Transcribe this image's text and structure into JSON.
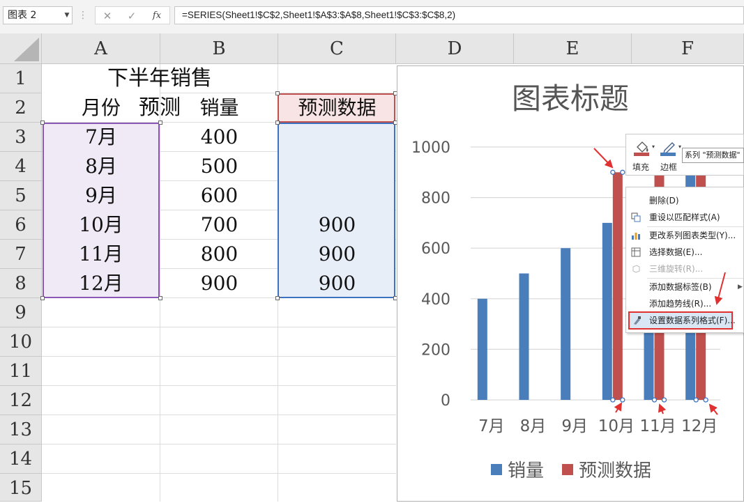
{
  "name_box": "图表 2",
  "toolbar": {
    "cancel": "✕",
    "enter": "✓",
    "fx": "fx"
  },
  "formula": "=SERIES(Sheet1!$C$2,Sheet1!$A$3:$A$8,Sheet1!$C$3:$C$8,2)",
  "columns": [
    "A",
    "B",
    "C",
    "D",
    "E",
    "F"
  ],
  "rows": [
    "1",
    "2",
    "3",
    "4",
    "5",
    "6",
    "7",
    "8",
    "9",
    "10",
    "11",
    "12",
    "13",
    "14",
    "15"
  ],
  "sheet": {
    "title": "下半年销售预测",
    "headers": [
      "月份",
      "销量",
      "预测数据"
    ],
    "months": [
      "7月",
      "8月",
      "9月",
      "10月",
      "11月",
      "12月"
    ],
    "sales": [
      "400",
      "500",
      "600",
      "700",
      "800",
      "900"
    ],
    "forecast": [
      "",
      "",
      "",
      "900",
      "900",
      "900"
    ]
  },
  "chart_data": {
    "type": "bar",
    "title": "图表标题",
    "categories": [
      "7月",
      "8月",
      "9月",
      "10月",
      "11月",
      "12月"
    ],
    "series": [
      {
        "name": "销量",
        "values": [
          400,
          500,
          600,
          700,
          800,
          900
        ],
        "color": "#4a7ebb"
      },
      {
        "name": "预测数据",
        "values": [
          null,
          null,
          null,
          900,
          900,
          900
        ],
        "color": "#c0504d"
      }
    ],
    "ylim": [
      0,
      1000
    ],
    "yticks": [
      "0",
      "200",
      "400",
      "600",
      "800",
      "1000"
    ],
    "grid": true,
    "legend": "bottom"
  },
  "minibar": {
    "fill": "填充",
    "border": "边框"
  },
  "tooltip": "系列 \"预测数据\"",
  "menu": {
    "items": [
      {
        "label": "删除(D)",
        "disabled": false
      },
      {
        "label": "重设以匹配样式(A)",
        "disabled": false
      },
      {
        "label": "更改系列图表类型(Y)...",
        "disabled": false
      },
      {
        "label": "选择数据(E)...",
        "disabled": false
      },
      {
        "label": "三维旋转(R)...",
        "disabled": true
      },
      {
        "label": "添加数据标签(B)",
        "disabled": false
      },
      {
        "label": "添加趋势线(R)...",
        "disabled": false
      },
      {
        "label": "设置数据系列格式(F)...",
        "disabled": false
      }
    ]
  },
  "colors": {
    "accent_red": "#e03030",
    "series1": "#4a7ebb",
    "series2": "#c0504d"
  }
}
